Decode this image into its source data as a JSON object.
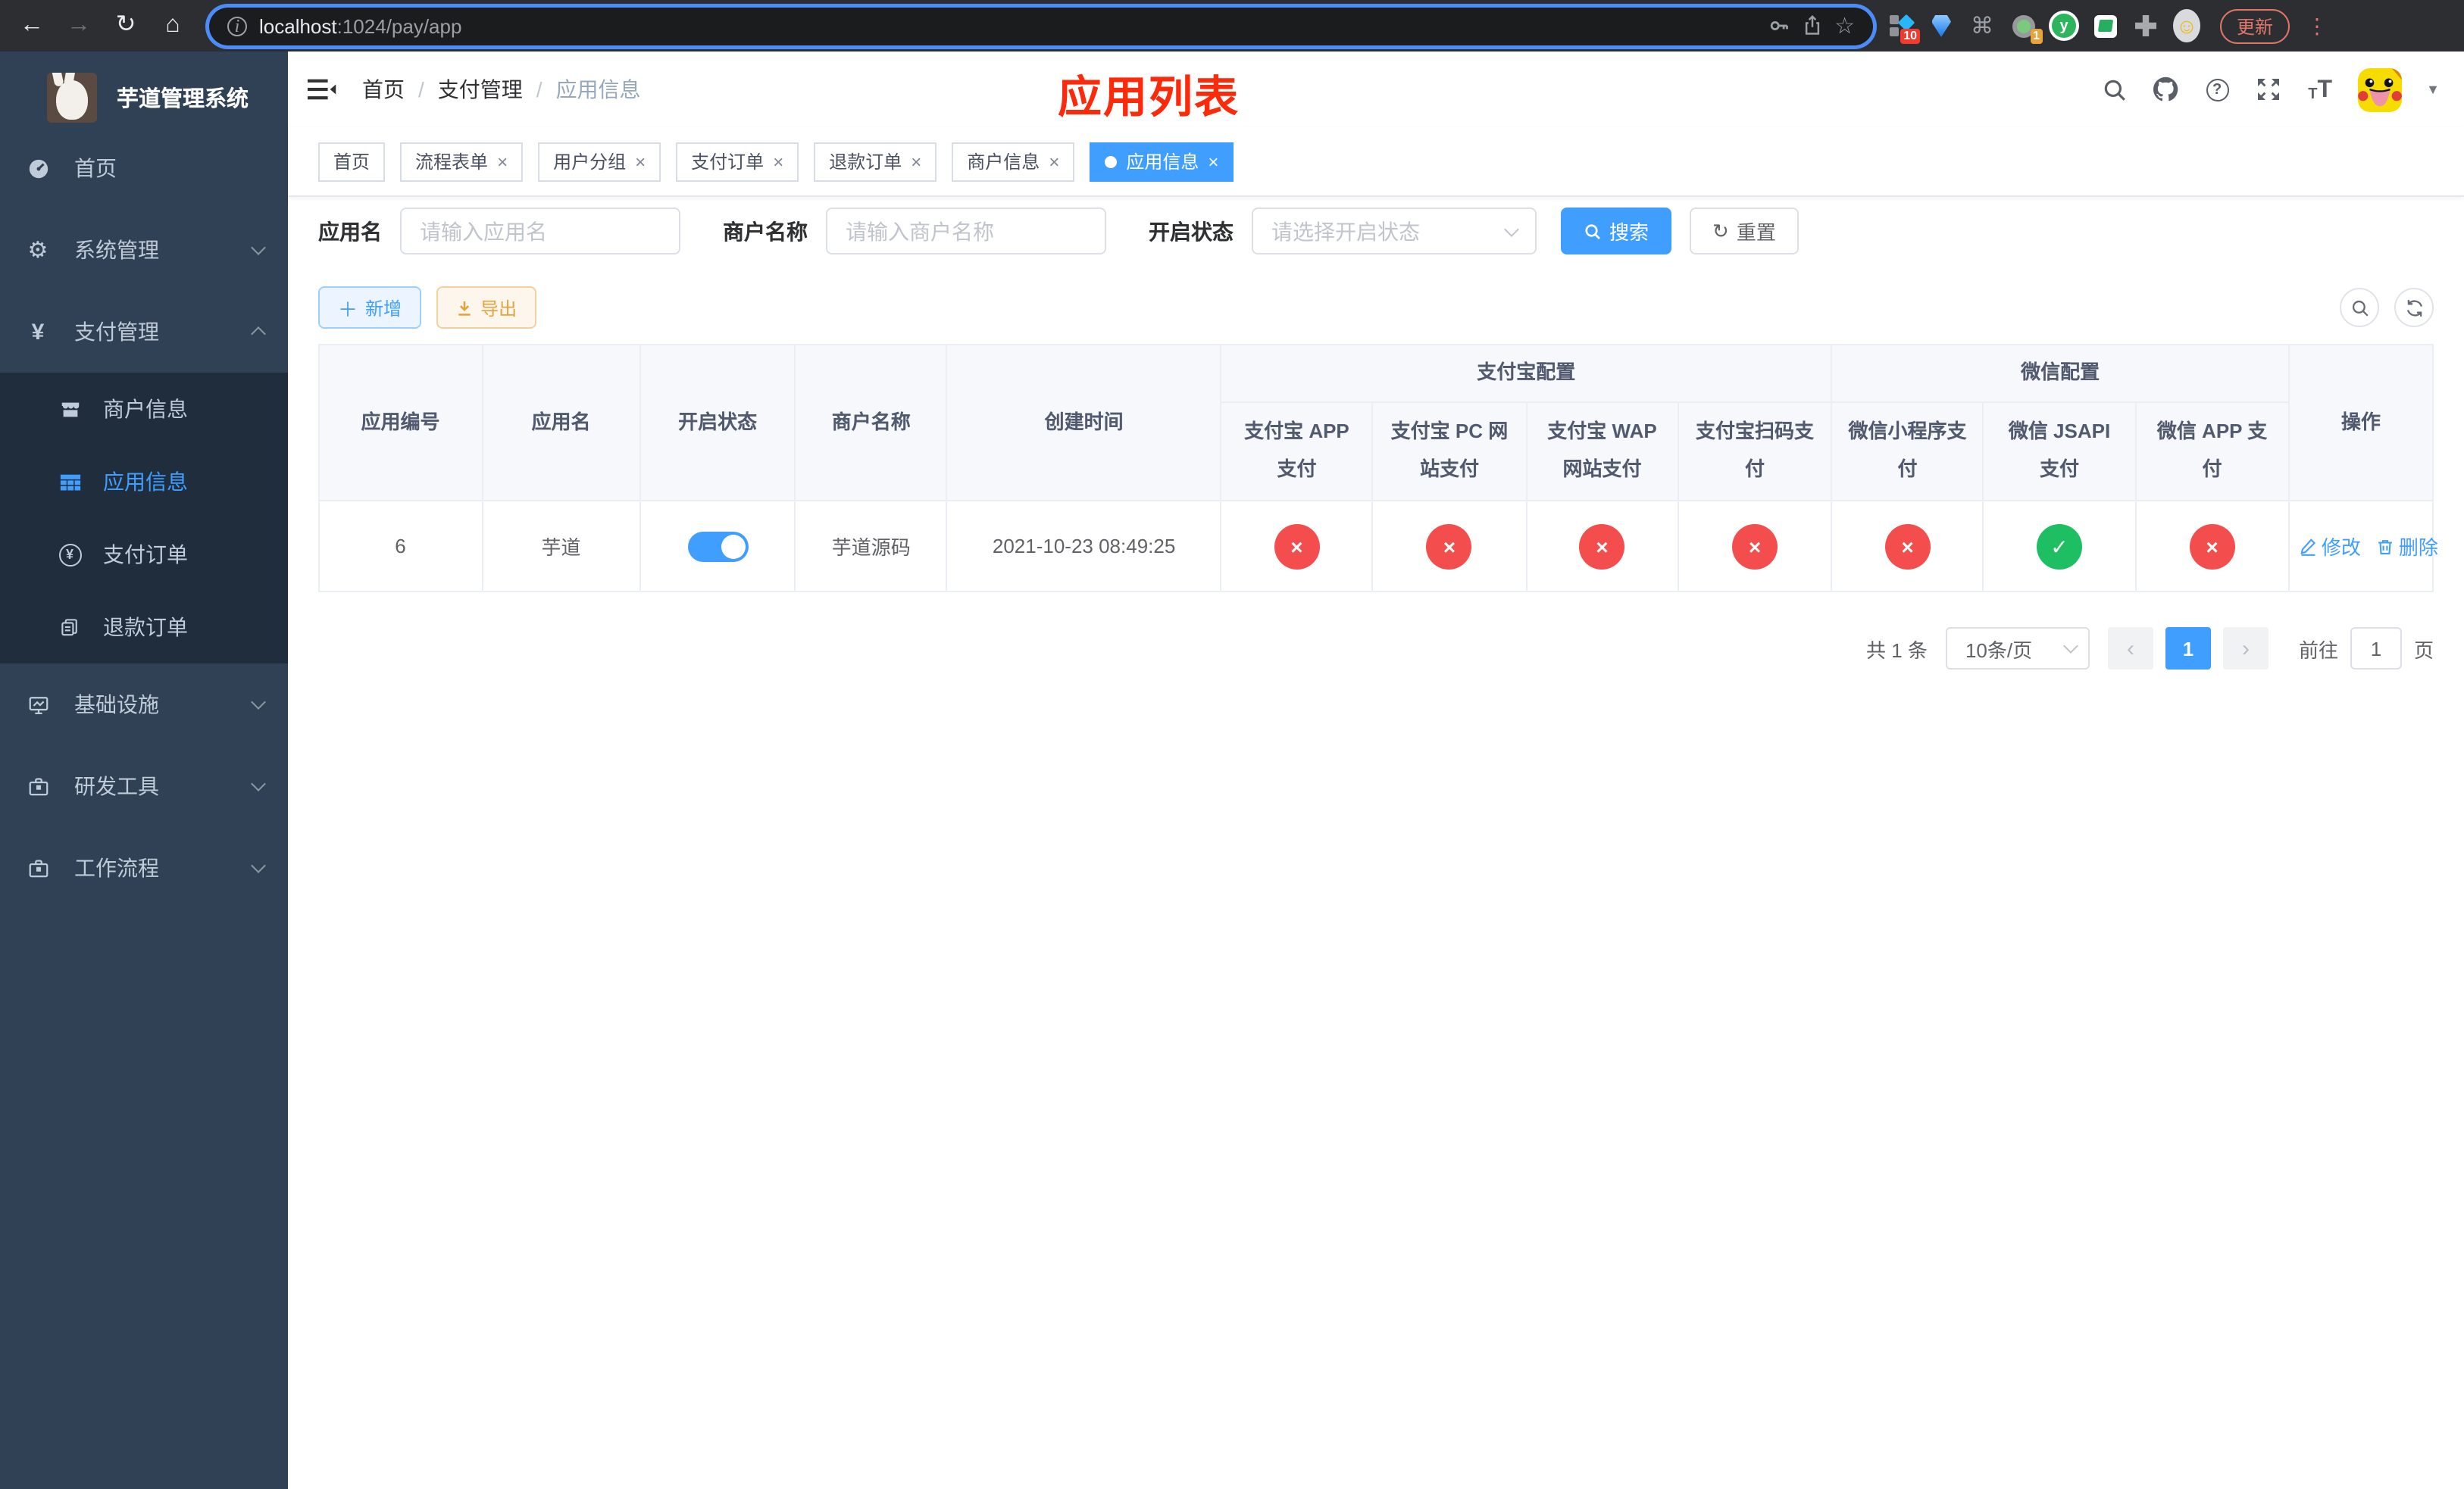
{
  "browser": {
    "url_host": "localhost",
    "url_path": ":1024/pay/app",
    "update_button": "更新",
    "ext_badge_blocks": "10",
    "ext_badge_record": "1"
  },
  "sidebar": {
    "title": "芋道管理系统",
    "items": {
      "home": "首页",
      "system": "系统管理",
      "payment": "支付管理",
      "infra": "基础设施",
      "devtools": "研发工具",
      "workflow": "工作流程"
    },
    "payment_children": {
      "merchant": "商户信息",
      "app": "应用信息",
      "pay_order": "支付订单",
      "refund_order": "退款订单"
    }
  },
  "navbar": {
    "breadcrumb": [
      "首页",
      "支付管理",
      "应用信息"
    ],
    "page_title": "应用列表"
  },
  "tabs": [
    {
      "label": "首页"
    },
    {
      "label": "流程表单"
    },
    {
      "label": "用户分组"
    },
    {
      "label": "支付订单"
    },
    {
      "label": "退款订单"
    },
    {
      "label": "商户信息"
    },
    {
      "label": "应用信息"
    }
  ],
  "filters": {
    "app_name_label": "应用名",
    "app_name_placeholder": "请输入应用名",
    "merchant_label": "商户名称",
    "merchant_placeholder": "请输入商户名称",
    "status_label": "开启状态",
    "status_placeholder": "请选择开启状态",
    "search_button": "搜索",
    "reset_button": "重置"
  },
  "toolbar": {
    "add_button": "新增",
    "export_button": "导出"
  },
  "table": {
    "columns": [
      "应用编号",
      "应用名",
      "开启状态",
      "商户名称",
      "创建时间"
    ],
    "groups": [
      {
        "label": "支付宝配置",
        "children": [
          "支付宝 APP 支付",
          "支付宝 PC 网站支付",
          "支付宝 WAP 网站支付",
          "支付宝扫码支付"
        ]
      },
      {
        "label": "微信配置",
        "children": [
          "微信小程序支付",
          "微信 JSAPI 支付",
          "微信 APP 支付"
        ]
      }
    ],
    "actions_column": "操作",
    "row": {
      "id": "6",
      "name": "芋道",
      "enabled": true,
      "merchant": "芋道源码",
      "created_at": "2021-10-23 08:49:25",
      "channel_status": [
        false,
        false,
        false,
        false,
        false,
        true,
        false
      ],
      "edit_action": "修改",
      "delete_action": "删除"
    }
  },
  "pagination": {
    "total": "共 1 条",
    "page_size": "10条/页",
    "current_page": "1",
    "goto_label": "前往",
    "goto_value": "1",
    "page_unit": "页"
  },
  "colors": {
    "accent": "#409eff",
    "danger": "#f34d4d",
    "success": "#1dbf62",
    "page_title_red": "#fa2a0a"
  }
}
